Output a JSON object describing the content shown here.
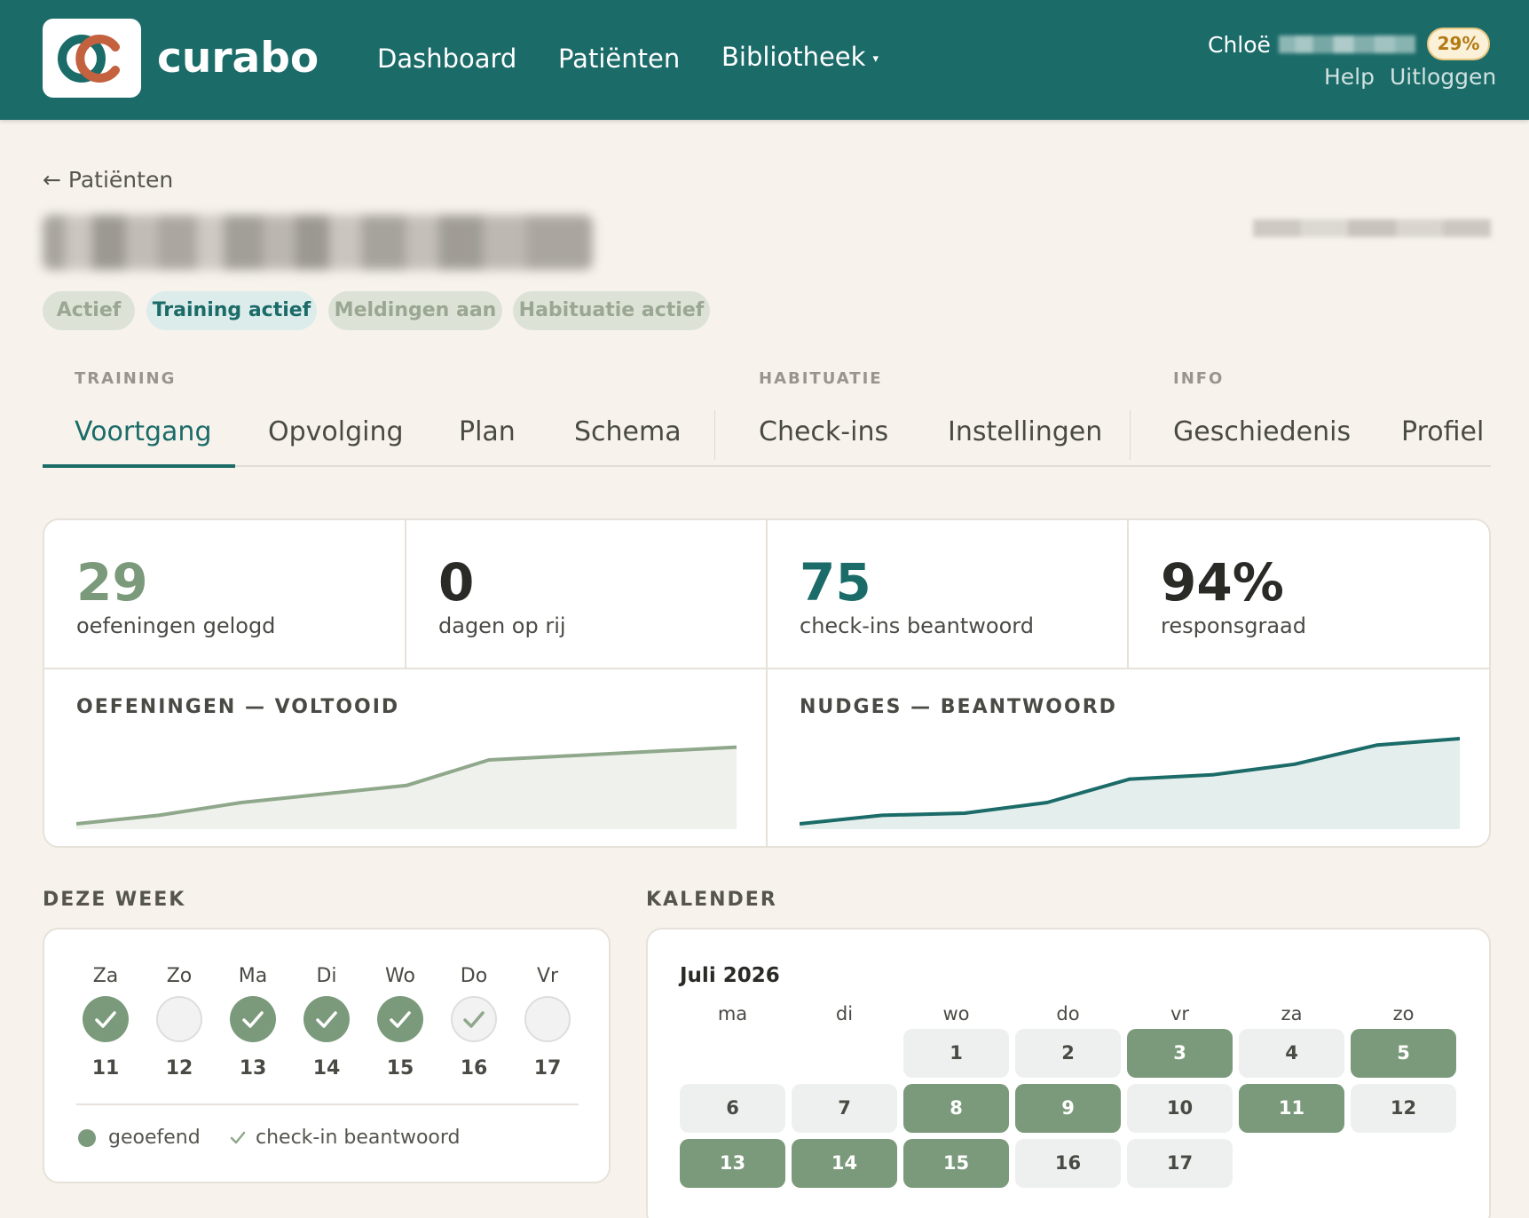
{
  "header": {
    "brand": "curabo",
    "nav": [
      {
        "label": "Dashboard"
      },
      {
        "label": "Patiënten"
      },
      {
        "label": "Bibliotheek",
        "caret": "▾"
      }
    ],
    "user_first_name": "Chloë",
    "progress_badge": "29%",
    "help_label": "Help",
    "logout_label": "Uitloggen"
  },
  "page": {
    "back_label": "← Patiënten",
    "chips": [
      "Actief",
      "Training actief",
      "Meldingen aan",
      "Habituatie actief"
    ]
  },
  "tabs": {
    "groups": [
      "TRAINING",
      "HABITUATIE",
      "INFO"
    ],
    "items": [
      "Voortgang",
      "Opvolging",
      "Plan",
      "Schema",
      "Check-ins",
      "Instellingen",
      "Geschiedenis",
      "Profiel"
    ],
    "current": "Voortgang"
  },
  "stats": [
    {
      "value": "29",
      "label": "oefeningen gelogd",
      "color": "#7b9a7b"
    },
    {
      "value": "0",
      "label": "dagen op rij",
      "color": "#2a2a26"
    },
    {
      "value": "75",
      "label": "check-ins beantwoord",
      "color": "#1b6b69"
    },
    {
      "value": "94%",
      "label": "responsgraad",
      "color": "#2a2a26"
    }
  ],
  "chart_data": [
    {
      "type": "area",
      "title": "OEFENINGEN — VOLTOOID",
      "x": [
        0,
        1,
        2,
        3,
        4,
        5,
        6,
        7,
        8
      ],
      "values": [
        0,
        2,
        5,
        7,
        9,
        15,
        16,
        17,
        18
      ],
      "ylim": [
        0,
        20
      ],
      "color": "#8fa88b",
      "fill": "#eef1ec"
    },
    {
      "type": "area",
      "title": "NUDGES — BEANTWOORD",
      "x": [
        0,
        1,
        2,
        3,
        4,
        5,
        6,
        7,
        8
      ],
      "values": [
        0,
        2,
        2.5,
        5,
        10.5,
        11.5,
        14,
        18.5,
        20
      ],
      "ylim": [
        0,
        20
      ],
      "color": "#1b6b69",
      "fill": "#e4eeec"
    }
  ],
  "week": {
    "title": "DEZE WEEK",
    "days": [
      {
        "day": "Za",
        "date": "11",
        "state": "done"
      },
      {
        "day": "Zo",
        "date": "12",
        "state": "empty"
      },
      {
        "day": "Ma",
        "date": "13",
        "state": "done"
      },
      {
        "day": "Di",
        "date": "14",
        "state": "done"
      },
      {
        "day": "Wo",
        "date": "15",
        "state": "done"
      },
      {
        "day": "Do",
        "date": "16",
        "state": "checkin"
      },
      {
        "day": "Vr",
        "date": "17",
        "state": "empty"
      }
    ],
    "legend_practiced": "geoefend",
    "legend_checkin": "check-in beantwoord"
  },
  "calendar": {
    "title": "KALENDER",
    "month": "Juli 2026",
    "dow": [
      "ma",
      "di",
      "wo",
      "do",
      "vr",
      "za",
      "zo"
    ],
    "first_weekday_index": 2,
    "days": [
      {
        "d": "1",
        "green": false
      },
      {
        "d": "2",
        "green": false
      },
      {
        "d": "3",
        "green": true
      },
      {
        "d": "4",
        "green": false
      },
      {
        "d": "5",
        "green": true
      },
      {
        "d": "6",
        "green": false
      },
      {
        "d": "7",
        "green": false
      },
      {
        "d": "8",
        "green": true
      },
      {
        "d": "9",
        "green": true
      },
      {
        "d": "10",
        "green": false
      },
      {
        "d": "11",
        "green": true
      },
      {
        "d": "12",
        "green": false
      },
      {
        "d": "13",
        "green": true
      },
      {
        "d": "14",
        "green": true
      },
      {
        "d": "15",
        "green": true
      },
      {
        "d": "16",
        "green": false
      },
      {
        "d": "17",
        "green": false
      }
    ]
  },
  "colors": {
    "brand": "#1b6b69",
    "practiced": "#7b9a7b",
    "background": "#f7f3ec"
  }
}
